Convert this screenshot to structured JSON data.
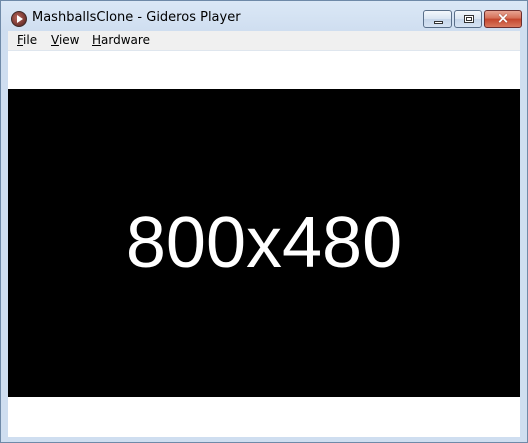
{
  "window": {
    "title": "MashballsClone - Gideros Player",
    "icon": "gideros-player-icon"
  },
  "controls": {
    "minimize": "minimize-icon",
    "maximize": "maximize-icon",
    "close": "close-icon",
    "close_glyph": "×"
  },
  "menu": {
    "items": [
      {
        "key": "F",
        "rest": "ile"
      },
      {
        "key": "V",
        "rest": "iew"
      },
      {
        "key": "H",
        "rest": "ardware"
      }
    ]
  },
  "stage": {
    "label": "800x480",
    "background": "#000000",
    "text_color": "#ffffff"
  }
}
